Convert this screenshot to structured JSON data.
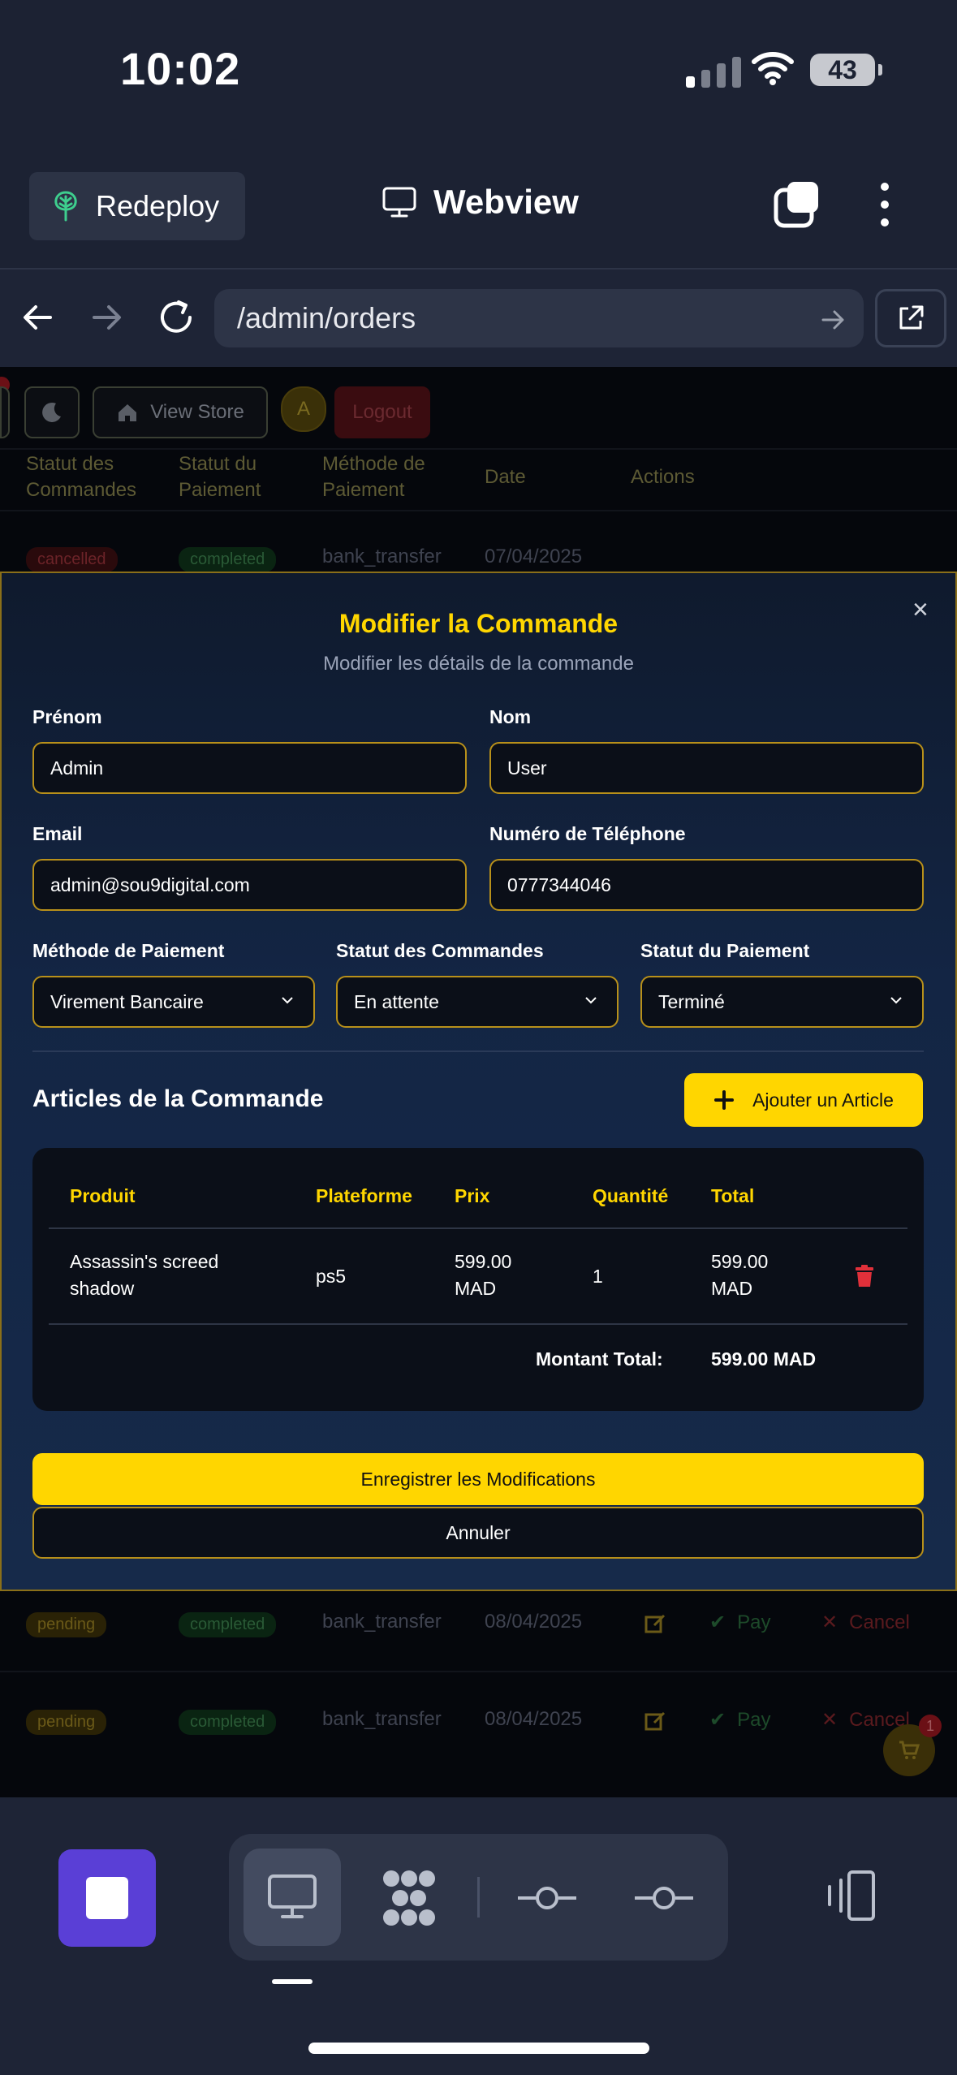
{
  "status_bar": {
    "time": "10:02",
    "battery": "43"
  },
  "app_bar": {
    "redeploy_label": "Redeploy",
    "webview_label": "Webview"
  },
  "browser": {
    "url": "/admin/orders"
  },
  "page_bg": {
    "view_store": "View Store",
    "avatar_letter": "A",
    "logout": "Logout",
    "headers": [
      "Statut des Commandes",
      "Statut du Paiement",
      "Méthode de Paiement",
      "Date",
      "Actions"
    ],
    "pay_label": "Pay",
    "cancel_label": "Cancel",
    "rows": [
      {
        "status": "cancelled",
        "payment": "completed",
        "method": "bank_transfer",
        "date": "07/04/2025"
      },
      {
        "status": "pending",
        "payment": "completed",
        "method": "bank_transfer",
        "date": "08/04/2025"
      },
      {
        "status": "pending",
        "payment": "completed",
        "method": "bank_transfer",
        "date": "08/04/2025"
      }
    ],
    "cart_count": "1"
  },
  "modal": {
    "title": "Modifier la Commande",
    "subtitle": "Modifier les détails de la commande",
    "close": "×",
    "first_name_label": "Prénom",
    "first_name": "Admin",
    "last_name_label": "Nom",
    "last_name": "User",
    "email_label": "Email",
    "email": "admin@sou9digital.com",
    "phone_label": "Numéro de Téléphone",
    "phone": "0777344046",
    "payment_method_label": "Méthode de Paiement",
    "payment_method": "Virement Bancaire",
    "order_status_label": "Statut des Commandes",
    "order_status": "En attente",
    "payment_status_label": "Statut du Paiement",
    "payment_status": "Terminé",
    "articles_title": "Articles de la Commande",
    "add_article": "Ajouter un Article",
    "table": {
      "headers": {
        "product": "Produit",
        "platform": "Plateforme",
        "price": "Prix",
        "quantity": "Quantité",
        "total": "Total"
      },
      "rows": [
        {
          "product_l1": "Assassin's screed",
          "product_l2": "shadow",
          "platform": "ps5",
          "price_l1": "599.00",
          "price_l2": "MAD",
          "quantity": "1",
          "total_l1": "599.00",
          "total_l2": "MAD"
        }
      ],
      "total_label": "Montant Total:",
      "total_value": "599.00 MAD"
    },
    "save": "Enregistrer les Modifications",
    "cancel": "Annuler"
  },
  "colors": {
    "accent": "#ffd600",
    "stop_button": "#5a3fd6",
    "delete": "#e0303a"
  }
}
